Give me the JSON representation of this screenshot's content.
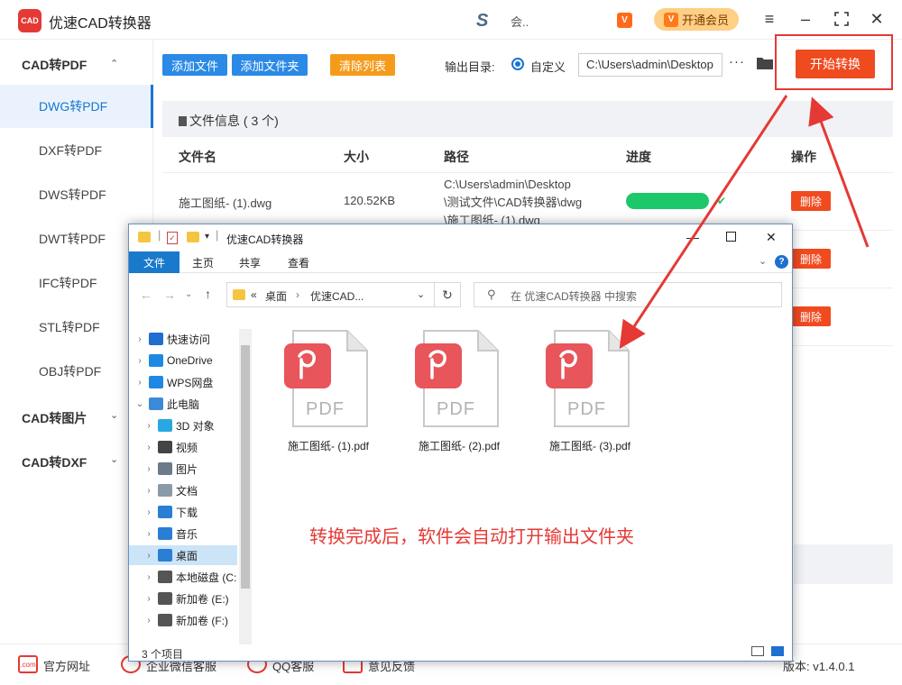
{
  "app": {
    "title": "优速CAD转换器",
    "logo_text": "CAD",
    "user_name": "会..",
    "vip_label": "开通会员",
    "vip_icon_text": "V"
  },
  "sidebar": {
    "categories": [
      {
        "label": "CAD转PDF",
        "expanded": true
      },
      {
        "label": "CAD转图片",
        "expanded": false
      },
      {
        "label": "CAD转DXF",
        "expanded": false
      }
    ],
    "items": [
      "DWG转PDF",
      "DXF转PDF",
      "DWS转PDF",
      "DWT转PDF",
      "IFC转PDF",
      "STL转PDF",
      "OBJ转PDF"
    ],
    "active_index": 0
  },
  "toolbar": {
    "add_file": "添加文件",
    "add_folder": "添加文件夹",
    "clear_list": "清除列表",
    "output_label": "输出目录:",
    "custom_label": "自定义",
    "output_path": "C:\\Users\\admin\\Desktop",
    "more_label": "···",
    "start_label": "开始转换"
  },
  "files": {
    "info_label": "文件信息",
    "count_label": "( 3 个)",
    "headers": {
      "name": "文件名",
      "size": "大小",
      "path": "路径",
      "progress": "进度",
      "action": "操作"
    },
    "rows": [
      {
        "name": "施工图纸- (1).dwg",
        "size": "120.52KB",
        "path_lines": [
          "C:\\Users\\admin\\Desktop",
          "\\测试文件\\CAD转换器\\dwg",
          "\\施工图纸- (1).dwg"
        ],
        "progress": 1.0,
        "delete": "删除"
      },
      {
        "delete": "删除"
      },
      {
        "delete": "删除"
      }
    ]
  },
  "footer": {
    "links": [
      "官方网址",
      "企业微信客服",
      "QQ客服",
      "意见反馈"
    ],
    "version": "版本: v1.4.0.1"
  },
  "explorer": {
    "title": "优速CAD转换器",
    "ribbon_tabs": [
      "文件",
      "主页",
      "共享",
      "查看"
    ],
    "address": [
      "«",
      "桌面",
      "›",
      "优速CAD..."
    ],
    "search_placeholder": "在 优速CAD转换器 中搜索",
    "nav": [
      {
        "label": "快速访问",
        "chev": "›",
        "icon": "quick-access-icon",
        "color": "#1e6fcf"
      },
      {
        "label": "OneDrive",
        "chev": "›",
        "icon": "onedrive-icon",
        "color": "#1e88e5"
      },
      {
        "label": "WPS网盘",
        "chev": "›",
        "icon": "wps-cloud-icon",
        "color": "#1e88e5"
      },
      {
        "label": "此电脑",
        "chev": "⌄",
        "icon": "pc-icon",
        "color": "#3b8ad8"
      },
      {
        "label": "3D 对象",
        "chev": "›",
        "icon": "3d-objects-icon",
        "color": "#29a7e0"
      },
      {
        "label": "视频",
        "chev": "›",
        "icon": "video-icon",
        "color": "#444"
      },
      {
        "label": "图片",
        "chev": "›",
        "icon": "pictures-icon",
        "color": "#6c7a89"
      },
      {
        "label": "文档",
        "chev": "›",
        "icon": "documents-icon",
        "color": "#8a9aa8"
      },
      {
        "label": "下载",
        "chev": "›",
        "icon": "downloads-icon",
        "color": "#2a7fd4"
      },
      {
        "label": "音乐",
        "chev": "›",
        "icon": "music-icon",
        "color": "#2a7fd4"
      },
      {
        "label": "桌面",
        "chev": "›",
        "icon": "desktop-icon",
        "color": "#2a7fd4",
        "selected": true
      },
      {
        "label": "本地磁盘 (C:",
        "chev": "›",
        "icon": "drive-icon",
        "color": "#555"
      },
      {
        "label": "新加卷 (E:)",
        "chev": "›",
        "icon": "drive-icon",
        "color": "#555"
      },
      {
        "label": "新加卷 (F:)",
        "chev": "›",
        "icon": "drive-icon",
        "color": "#555"
      }
    ],
    "files": [
      "施工图纸- (1).pdf",
      "施工图纸- (2).pdf",
      "施工图纸- (3).pdf"
    ],
    "pdf_badge": "PDF",
    "status": "3 个项目"
  },
  "annotation": "转换完成后，软件会自动打开输出文件夹",
  "colors": {
    "accent": "#1677d2",
    "danger": "#f04a1f",
    "orange": "#f59b1c",
    "progress": "#1dc86b",
    "highlight": "#e53935"
  }
}
